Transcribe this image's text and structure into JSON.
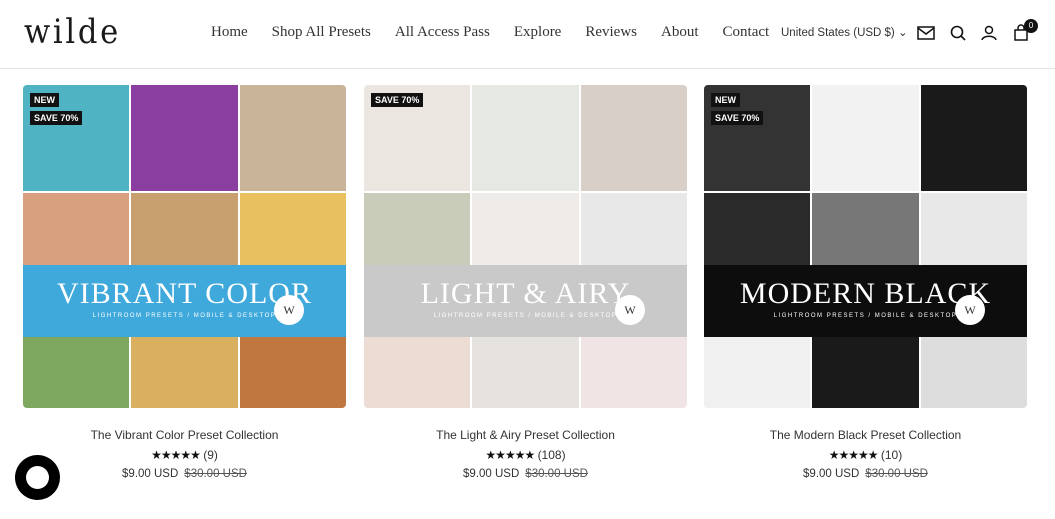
{
  "header": {
    "logo": "wilde",
    "nav": [
      "Home",
      "Shop All Presets",
      "All Access Pass",
      "Explore",
      "Reviews",
      "About",
      "Contact"
    ],
    "locale": "United States (USD $)",
    "cart_count": "0"
  },
  "products": [
    {
      "name": "The Vibrant Color Preset Collection",
      "banner_title": "VIBRANT COLOR",
      "banner_sub": "LIGHTROOM PRESETS / MOBILE & DESKTOP",
      "badges": [
        "NEW",
        "SAVE 70%"
      ],
      "stars": "★★★★★",
      "reviews": "(9)",
      "price": "$9.00 USD",
      "compare_price": "$30.00 USD",
      "banner_color": "#3fa9dc",
      "tiles": [
        "#4fb3c4",
        "#8a3fa0",
        "#c9b49a",
        "#d9a080",
        "#c8a070",
        "#e8c060",
        "#7ea860",
        "#d8b060",
        "#c07840"
      ]
    },
    {
      "name": "The Light & Airy Preset Collection",
      "banner_title": "LIGHT & AIRY",
      "banner_sub": "LIGHTROOM PRESETS / MOBILE & DESKTOP",
      "badges": [
        "SAVE 70%"
      ],
      "stars": "★★★★★",
      "reviews": "(108)",
      "price": "$9.00 USD",
      "compare_price": "$30.00 USD",
      "banner_color": "#c9c9c9",
      "tiles": [
        "#ece6e0",
        "#e6e8e2",
        "#d8cfc8",
        "#c8ccb8",
        "#efebe8",
        "#e8e8e8",
        "#ecdcd4",
        "#e6e2de",
        "#f0e4e4"
      ]
    },
    {
      "name": "The Modern Black Preset Collection",
      "banner_title": "MODERN BLACK",
      "banner_sub": "LIGHTROOM PRESETS / MOBILE & DESKTOP",
      "badges": [
        "NEW",
        "SAVE 70%"
      ],
      "stars": "★★★★★",
      "reviews": "(10)",
      "price": "$9.00 USD",
      "compare_price": "$30.00 USD",
      "banner_color": "#0d0d0d",
      "tiles": [
        "#333",
        "#f2f2f2",
        "#1a1a1a",
        "#2a2a2a",
        "#777",
        "#e8e8e8",
        "#f0f0f0",
        "#1a1a1a",
        "#ddd"
      ]
    }
  ]
}
